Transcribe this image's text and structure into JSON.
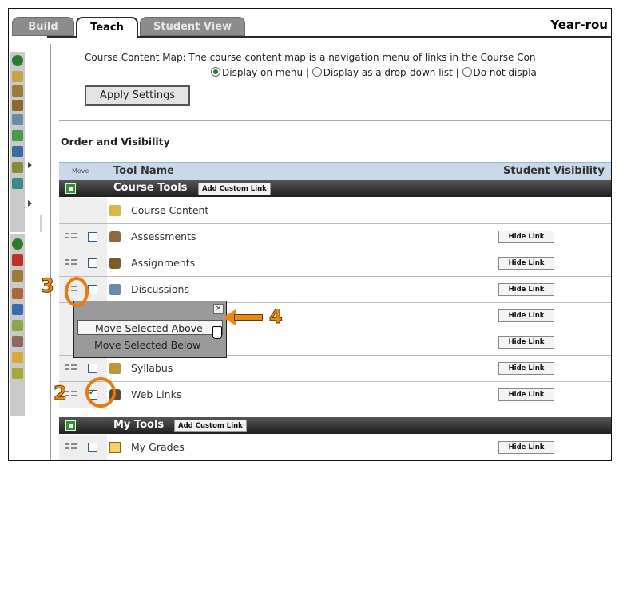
{
  "tabs": [
    {
      "label": "Build",
      "state": "inactive"
    },
    {
      "label": "Teach",
      "state": "active"
    },
    {
      "label": "Student View",
      "state": "inactive"
    }
  ],
  "page_title": "Year-rou",
  "content_map": {
    "description": "Course Content Map:  The course content map is a navigation menu of links in the Course Con",
    "options": [
      {
        "label": "Display on menu",
        "selected": true
      },
      {
        "label": "Display as a drop-down list",
        "selected": false
      },
      {
        "label": "Do not displa",
        "selected": false
      }
    ],
    "separator": "|"
  },
  "apply_button": "Apply Settings",
  "order_section": {
    "title": "Order and Visibility",
    "columns": {
      "move": "Move",
      "tool_name": "Tool Name",
      "visibility": "Student Visibility"
    }
  },
  "groups": [
    {
      "name": "Course Tools",
      "custom_link_button": "Add Custom Link",
      "rows": [
        {
          "name": "Course Content",
          "icon": "course-content-icon",
          "movable": false,
          "checked": false,
          "hide_link": ""
        },
        {
          "name": "Assessments",
          "icon": "assessments-icon",
          "movable": true,
          "checked": false,
          "hide_link": "Hide Link"
        },
        {
          "name": "Assignments",
          "icon": "assignments-icon",
          "movable": true,
          "checked": false,
          "hide_link": "Hide Link"
        },
        {
          "name": "Discussions",
          "icon": "discussions-icon",
          "movable": true,
          "checked": false,
          "hide_link": "Hide Link"
        },
        {
          "name": "",
          "icon": "",
          "movable": true,
          "checked": false,
          "hide_link": "Hide Link"
        },
        {
          "name": "",
          "icon": "",
          "movable": true,
          "checked": false,
          "hide_link": "Hide Link"
        },
        {
          "name": "Syllabus",
          "icon": "syllabus-icon",
          "movable": true,
          "checked": false,
          "hide_link": "Hide Link"
        },
        {
          "name": "Web Links",
          "icon": "web-links-icon",
          "movable": true,
          "checked": true,
          "hide_link": "Hide Link"
        }
      ]
    },
    {
      "name": "My Tools",
      "custom_link_button": "Add Custom Link",
      "rows": [
        {
          "name": "My Grades",
          "icon": "my-grades-icon",
          "movable": true,
          "checked": false,
          "hide_link": "Hide Link"
        }
      ]
    }
  ],
  "move_popup": {
    "close": "×",
    "above": "Move Selected Above",
    "below": "Move Selected Below"
  },
  "callouts": {
    "two": "2",
    "three": "3",
    "four": "4"
  },
  "colors": {
    "callout": "#e88a10",
    "group_bar": "#2b2b2b",
    "header_bg": "#c9d8ea"
  }
}
